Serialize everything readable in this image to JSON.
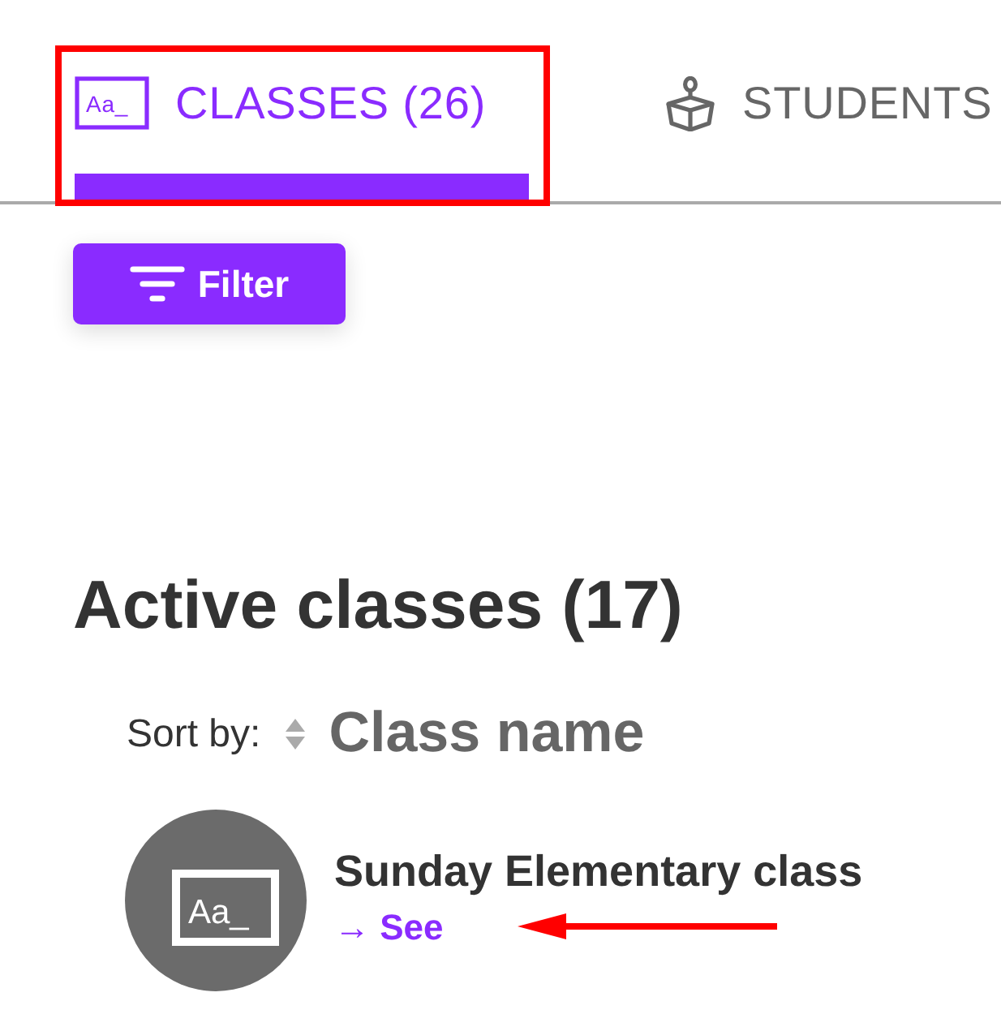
{
  "tabs": [
    {
      "label": "CLASSES (26)",
      "icon_label": "Aa_",
      "selected": true,
      "highlighted": true
    },
    {
      "label": "STUDENTS",
      "selected": false,
      "highlighted": false
    }
  ],
  "filter_button": {
    "label": "Filter"
  },
  "section": {
    "title": "Active classes (17)",
    "sort": {
      "label": "Sort by:",
      "value": "Class name"
    }
  },
  "classes": [
    {
      "name": "Sunday Elementary class",
      "icon_label": "Aa_",
      "link": "→ See",
      "arrow_annotation": true
    }
  ]
}
